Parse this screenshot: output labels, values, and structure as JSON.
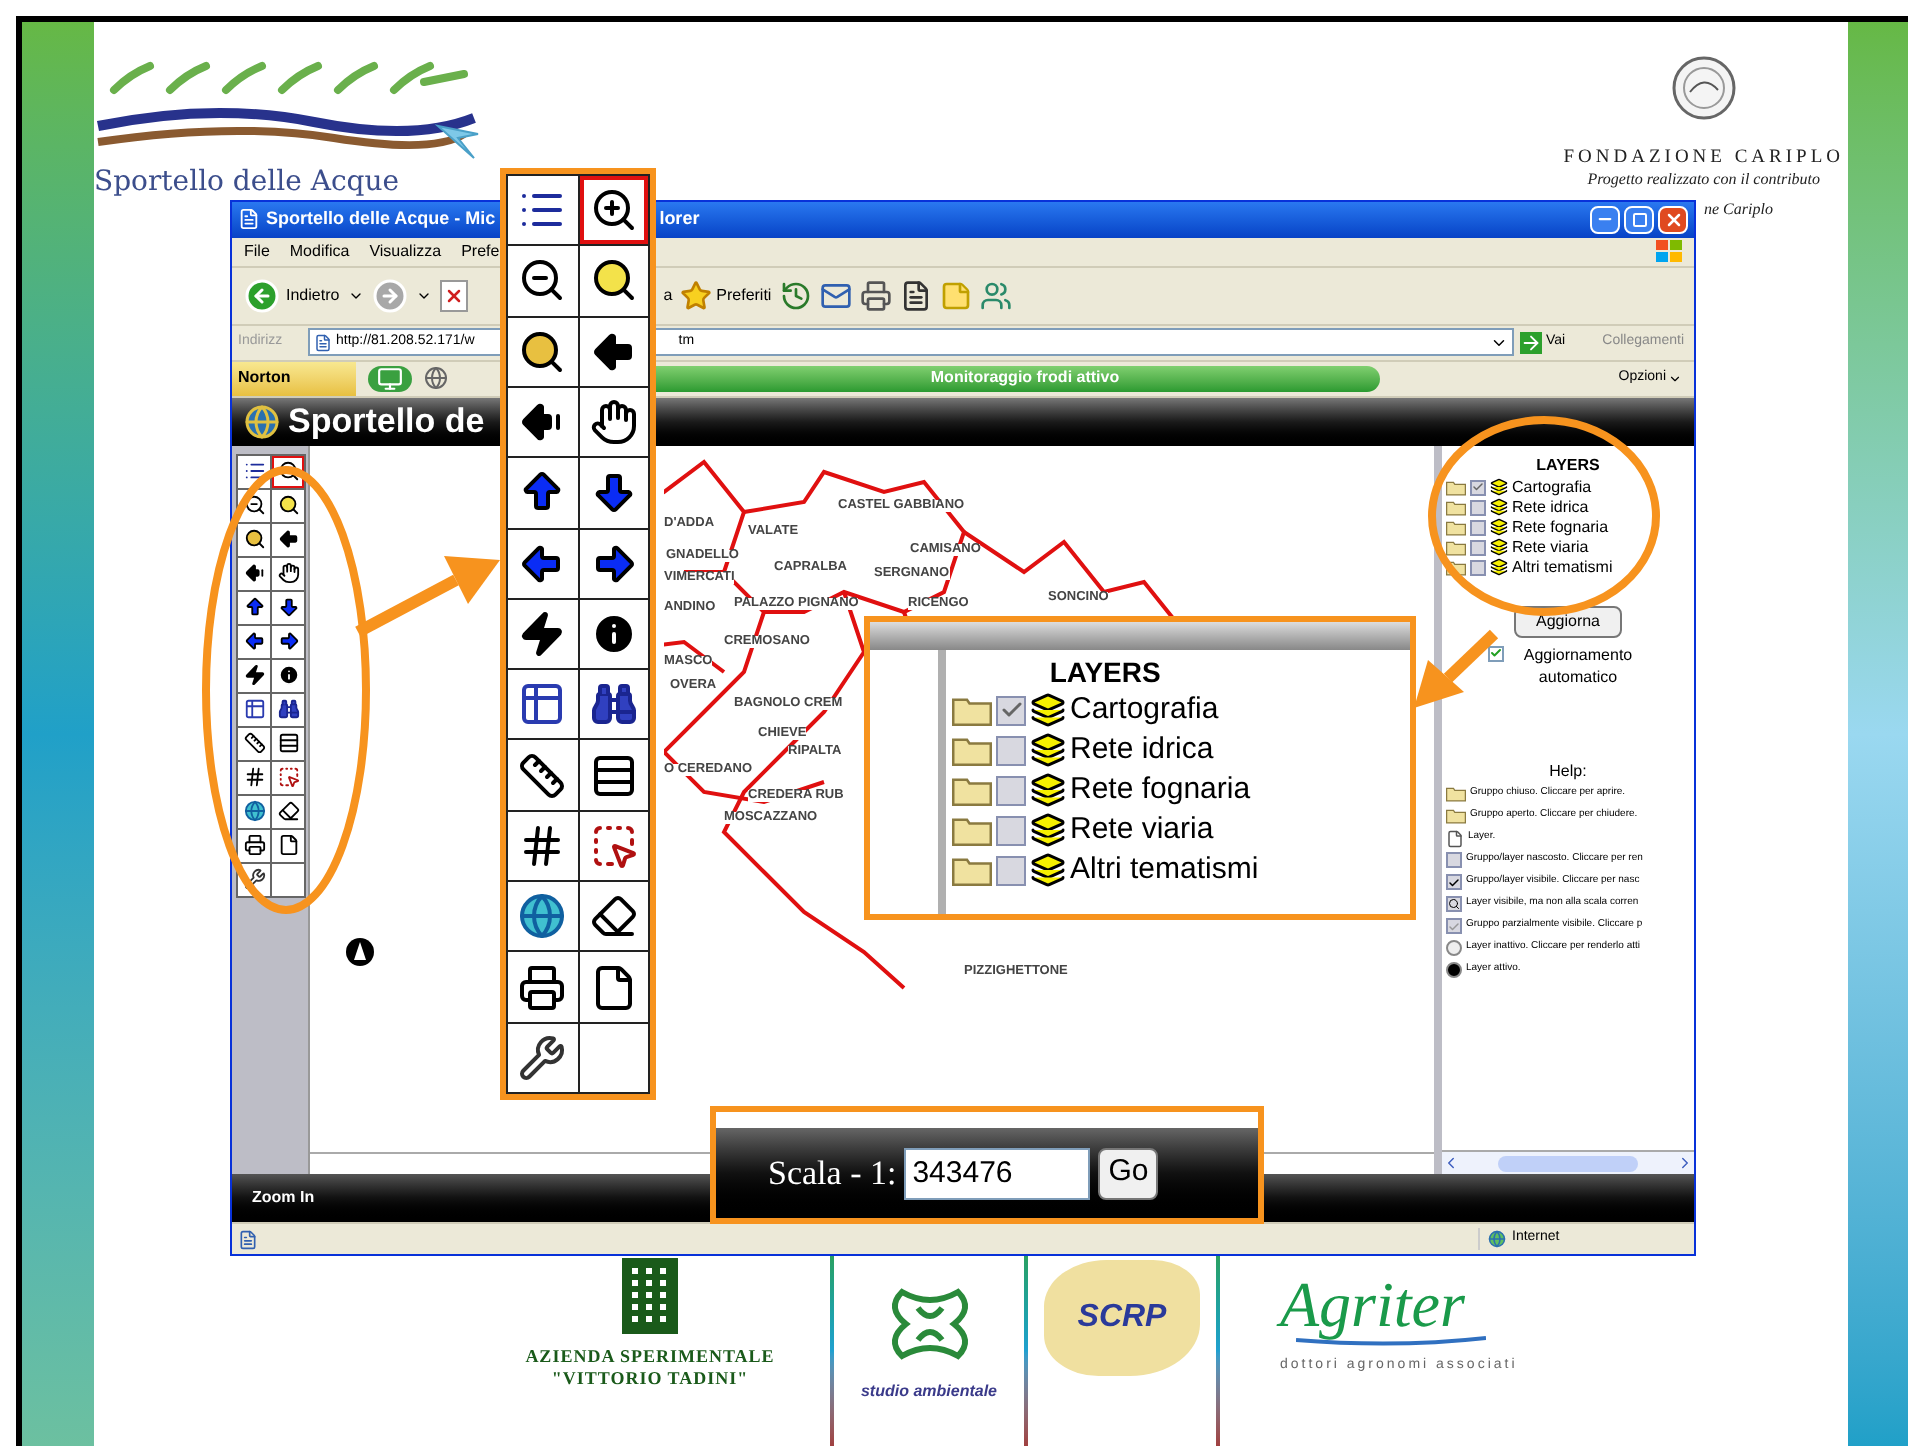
{
  "slide_header": {
    "logo_text": "Sportello delle Acque",
    "sponsor_name": "FONDAZIONE CARIPLO",
    "sponsor_note": "Progetto realizzato con il contributo",
    "sponsor_note_tail": "ne Cariplo"
  },
  "browser": {
    "title": "Sportello delle Acque - Mic",
    "title_tail": "lorer",
    "menu": [
      "File",
      "Modifica",
      "Visualizza",
      "Prefe"
    ],
    "toolbar": {
      "back": "Indietro",
      "fragment": "a",
      "favorites": "Preferiti"
    },
    "address": {
      "label": "Indirizz",
      "url": "http://81.208.52.171/w",
      "url_tail": "tm",
      "go": "Vai",
      "links": "Collegamenti"
    },
    "norton": {
      "label": "Norton",
      "status": "Monitoraggio frodi attivo",
      "options": "Opzioni"
    },
    "status_bar": {
      "zone": "Internet"
    }
  },
  "app": {
    "title": "Sportello de",
    "toolbar": {
      "tools": [
        {
          "selected": false
        },
        {
          "selected": true
        },
        {
          "selected": false
        },
        {
          "selected": false
        },
        {
          "selected": false
        },
        {
          "selected": false
        },
        {
          "selected": false
        },
        {
          "selected": false
        },
        {
          "selected": false
        },
        {
          "selected": false
        },
        {
          "selected": false
        },
        {
          "selected": false
        },
        {
          "selected": false
        },
        {
          "selected": false
        },
        {
          "selected": false
        },
        {
          "selected": false
        },
        {
          "selected": false
        },
        {
          "selected": false
        },
        {
          "selected": false
        },
        {
          "selected": false
        },
        {
          "selected": false
        },
        {
          "selected": false
        },
        {
          "selected": false
        },
        {
          "selected": false
        },
        {
          "selected": false
        }
      ]
    },
    "map": {
      "place_labels": [
        "CASTEL GABBIANO",
        "D'ADDA",
        "VALATE",
        "GNADELLO",
        "CAMISANO",
        "CAPRALBA",
        "SERGNANO",
        "VIMERCATI",
        "SONCINO",
        "ANDINO",
        "PALAZZO PIGNANO",
        "RICENGO",
        "CREMOSANO",
        "MASCO",
        "OVERA",
        "BAGNOLO CREM",
        "CHIEVE",
        "RIPALTA",
        "O CEREDANO",
        "CREDERA RUB",
        "MOSCAZZANO",
        "PIZZIGHETTONE"
      ]
    },
    "layers_panel": {
      "title": "LAYERS",
      "layers": [
        {
          "name": "Cartografia",
          "checked": true
        },
        {
          "name": "Rete idrica",
          "checked": false
        },
        {
          "name": "Rete fognaria",
          "checked": false
        },
        {
          "name": "Rete viaria",
          "checked": false
        },
        {
          "name": "Altri tematismi",
          "checked": false
        }
      ],
      "refresh_button": "Aggiorna",
      "auto_update": {
        "label": "Aggiornamento automatico",
        "checked": true
      },
      "help_title": "Help:",
      "help_items": [
        "Gruppo chiuso. Cliccare per aprire.",
        "Gruppo aperto. Cliccare per chiudere.",
        "Layer.",
        "Gruppo/layer nascosto. Cliccare per ren",
        "Gruppo/layer visibile. Cliccare per nasc",
        "Layer visibile, ma non alla scala corren",
        "Gruppo parzialmente visibile. Cliccare p",
        "Layer inattivo. Cliccare per renderlo atti",
        "Layer attivo."
      ]
    },
    "status": "Zoom In"
  },
  "callouts": {
    "toolbar": {
      "tools": [
        {
          "selected": false
        },
        {
          "selected": true
        },
        {
          "selected": false
        },
        {
          "selected": false
        },
        {
          "selected": false
        },
        {
          "selected": false
        },
        {
          "selected": false
        },
        {
          "selected": false
        },
        {
          "selected": false
        },
        {
          "selected": false
        },
        {
          "selected": false
        },
        {
          "selected": false
        },
        {
          "selected": false
        },
        {
          "selected": false
        },
        {
          "selected": false
        },
        {
          "selected": false
        },
        {
          "selected": false
        },
        {
          "selected": false
        },
        {
          "selected": false
        },
        {
          "selected": false
        },
        {
          "selected": false
        },
        {
          "selected": false
        },
        {
          "selected": false
        },
        {
          "selected": false
        },
        {
          "selected": false
        }
      ]
    },
    "layers": {
      "title": "LAYERS",
      "layers": [
        {
          "name": "Cartografia",
          "checked": true
        },
        {
          "name": "Rete idrica",
          "checked": false
        },
        {
          "name": "Rete fognaria",
          "checked": false
        },
        {
          "name": "Rete viaria",
          "checked": false
        },
        {
          "name": "Altri tematismi",
          "checked": false
        }
      ]
    },
    "scale": {
      "label": "Scala - 1:",
      "value": "343476",
      "button": "Go"
    }
  },
  "footer": {
    "partner_1": [
      "AZIENDA SPERIMENTALE",
      "\"VITTORIO TADINI\""
    ],
    "partner_2": "studio ambientale",
    "partner_3": "SCRP",
    "partner_4": {
      "name": "Agriter",
      "tagline": "dottori agronomi associati"
    }
  }
}
